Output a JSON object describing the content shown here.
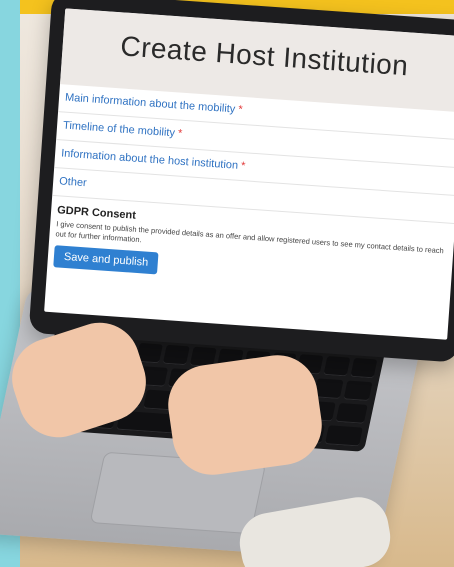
{
  "screen": {
    "title": "Create Host Institution",
    "sections": [
      {
        "label": "Main information about the mobility",
        "required_mark": "*"
      },
      {
        "label": "Timeline of the mobility",
        "required_mark": "*"
      },
      {
        "label": "Information about the host institution",
        "required_mark": "*"
      },
      {
        "label": "Other",
        "required_mark": ""
      }
    ],
    "gdpr": {
      "title": "GDPR Consent",
      "text": "I give consent to publish the provided details as an offer and allow registered users to see my contact details to reach out for further information."
    },
    "buttons": {
      "publish": "Save and publish"
    }
  },
  "colors": {
    "accent": "#2f80d1",
    "link": "#2f72c2",
    "required": "#e23b3b",
    "side_band": "#87d6df",
    "top_band": "#f4c21e"
  }
}
